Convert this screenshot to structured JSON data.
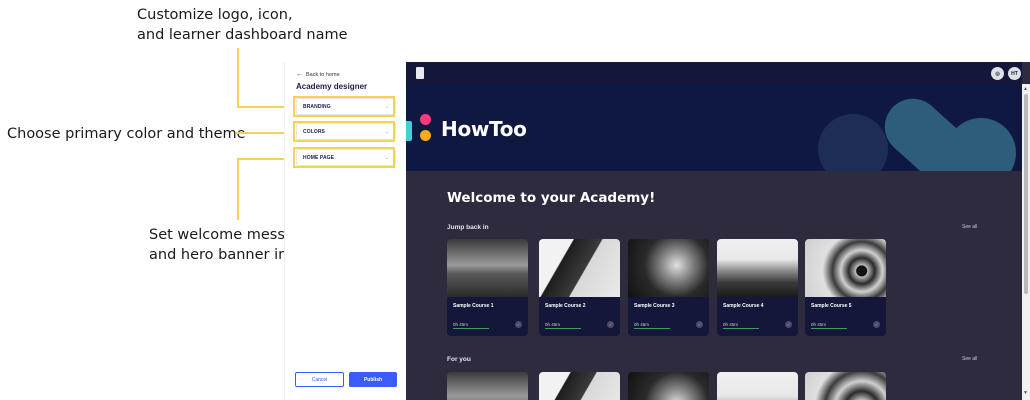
{
  "annotations": {
    "branding_line1": "Customize logo, icon,",
    "branding_line2": "and learner dashboard name",
    "colors": "Choose primary color and theme",
    "home_line1": "Set welcome message",
    "home_line2": "and hero banner image"
  },
  "designer": {
    "back_link": "Back to home",
    "title": "Academy designer",
    "sections": [
      "BRANDING",
      "COLORS",
      "HOME PAGE"
    ],
    "cancel_label": "Cancel",
    "publish_label": "Publish"
  },
  "preview": {
    "avatar_initials": "HT",
    "brand_name": "HowToo",
    "welcome": "Welcome to your Academy!",
    "jump_back_title": "Jump back in",
    "for_you_title": "For you",
    "see_all": "See all",
    "courses": [
      {
        "title": "Sample Course 1",
        "duration": "0h 45m",
        "progress": 0.45
      },
      {
        "title": "Sample Course 2",
        "duration": "0h 45m",
        "progress": 0.45
      },
      {
        "title": "Sample Course 3",
        "duration": "0h 45m",
        "progress": 0.45
      },
      {
        "title": "Sample Course 4",
        "duration": "0h 45m",
        "progress": 0.45
      },
      {
        "title": "Sample Course 5",
        "duration": "0h 45m",
        "progress": 0.45
      }
    ]
  },
  "colors": {
    "highlight": "#f7d154",
    "accent_blue": "#3b5bfd",
    "topbar": "#14163a",
    "hero": "#0f1840",
    "content_bg": "#2e2b3f"
  },
  "icons": {
    "back": "arrow-left-icon",
    "chevron": "chevron-down-icon",
    "menu": "hamburger-menu-icon",
    "help": "help-circle-icon",
    "check": "check-circle-icon"
  }
}
